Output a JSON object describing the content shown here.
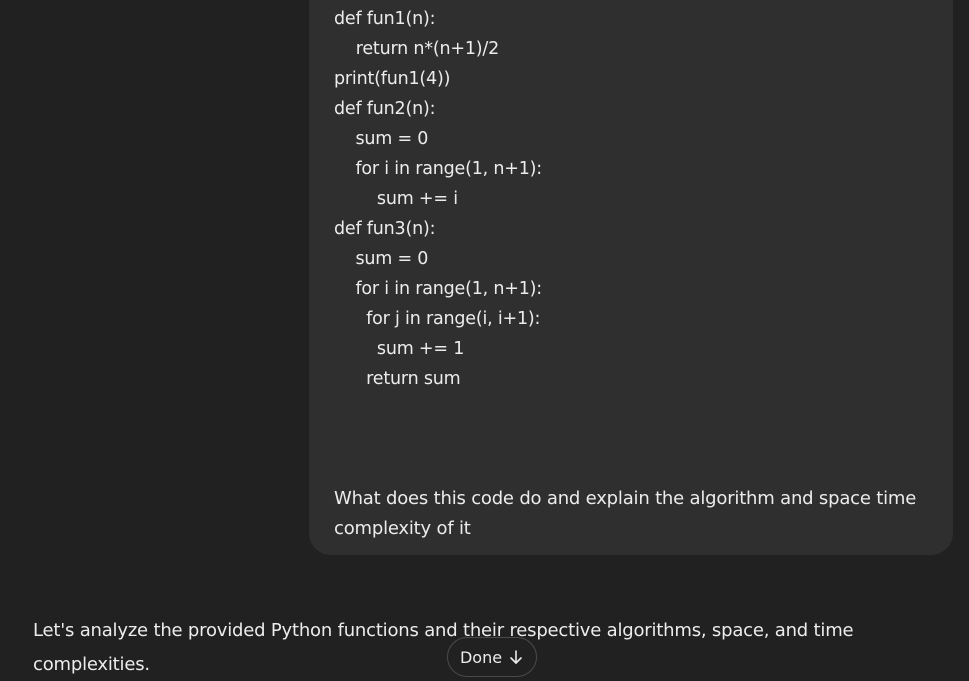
{
  "user_message": {
    "code_lines": [
      "def fun1(n):",
      "  return n*(n+1)/2",
      "print(fun1(4))",
      "def fun2(n):",
      "    sum = 0",
      "    for i in range(1, n+1):",
      "        sum += i",
      "def fun3(n):",
      "    sum = 0",
      "    for i in range(1, n+1):",
      "      for j in range(i, i+1):",
      "        sum += 1",
      "      return sum"
    ],
    "question": "What does this code do and explain the algorithm and space time complexity of it"
  },
  "assistant_message": {
    "text": "Let's analyze the provided Python functions and their respective algorithms, space, and time complexities."
  },
  "scroll_button": {
    "label": "Done",
    "icon": "arrow-down-icon"
  }
}
